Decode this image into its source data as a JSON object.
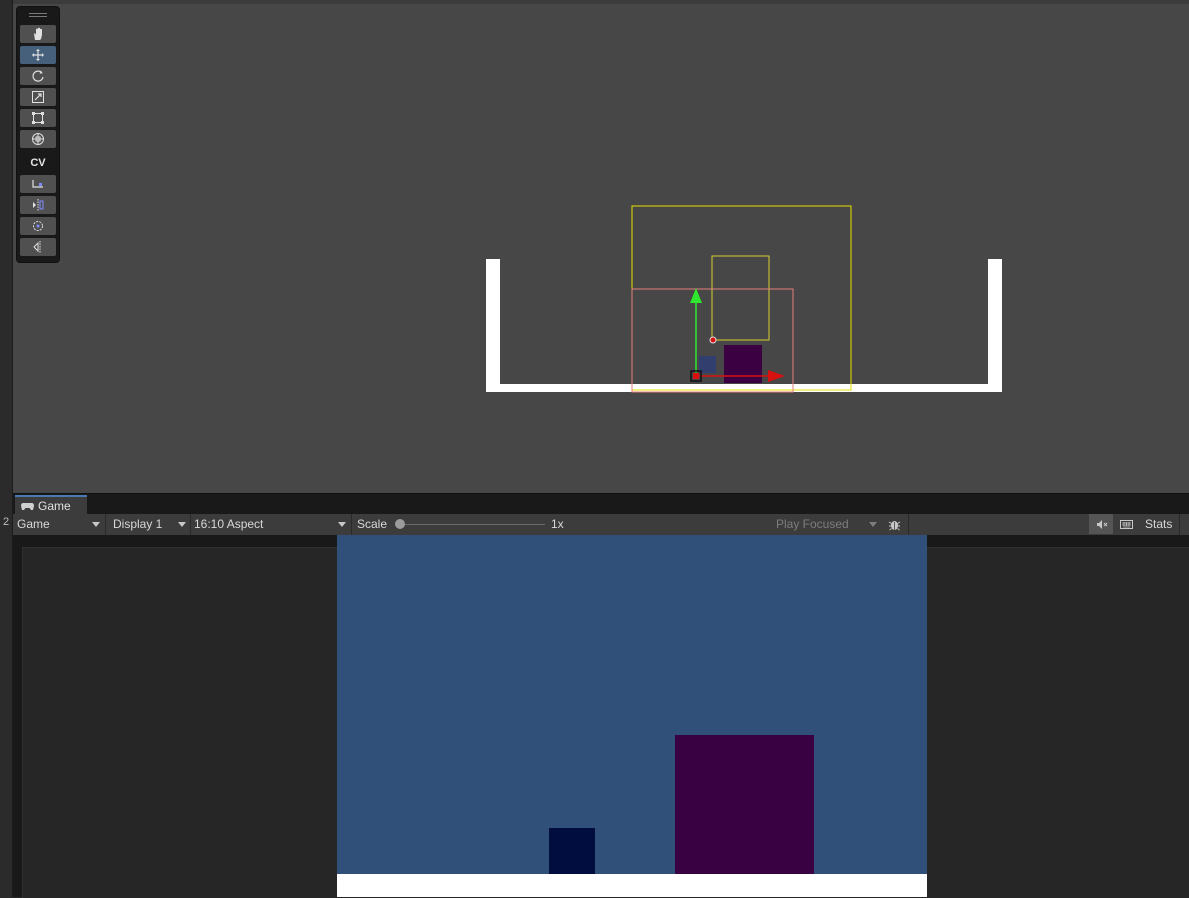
{
  "left_gutter": {
    "label": "2"
  },
  "scene": {
    "tool_palette": {
      "tools": [
        {
          "name": "hand-tool",
          "icon": "hand-icon"
        },
        {
          "name": "move-tool",
          "icon": "move-icon",
          "active": true
        },
        {
          "name": "rotate-tool",
          "icon": "rotate-icon"
        },
        {
          "name": "scale-tool",
          "icon": "scale-icon"
        },
        {
          "name": "rect-tool",
          "icon": "rect-icon"
        },
        {
          "name": "transform-tool",
          "icon": "transform-icon"
        }
      ],
      "cv_label": "CV",
      "custom_tools": [
        "snap-icon",
        "pivot-icon",
        "orbit-icon",
        "collider-icon"
      ]
    },
    "colors": {
      "background": "#474747",
      "ground": "#ffffff",
      "camera_frame": "#e8e000",
      "selection": "#e57c7c",
      "player": "#3a0042",
      "small_box": "#2c3c78",
      "gizmo_y": "#2ee82e",
      "gizmo_x": "#d81010"
    }
  },
  "game": {
    "tab_label": "Game",
    "toolbar": {
      "view_select": "Game",
      "display_select": "Display 1",
      "aspect_select": "16:10 Aspect",
      "scale_label": "Scale",
      "scale_value": "1x",
      "play_mode_select": "Play Focused",
      "stats_label": "Stats"
    },
    "colors": {
      "sky": "#305079",
      "small_box": "#000d3e",
      "big_box": "#390042",
      "ground": "#ffffff"
    }
  }
}
